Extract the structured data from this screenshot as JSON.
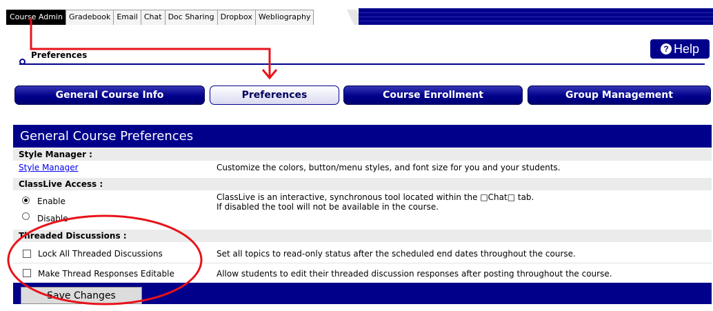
{
  "top_tabs": [
    "Course Admin",
    "Gradebook",
    "Email",
    "Chat",
    "Doc Sharing",
    "Dropbox",
    "Webliography"
  ],
  "page": {
    "title": "Preferences",
    "help_label": "Help"
  },
  "nav_buttons": [
    "General Course Info",
    "Preferences",
    "Course Enrollment",
    "Group Management"
  ],
  "panel": {
    "title": "General Course Preferences",
    "style_manager": {
      "heading": "Style Manager :",
      "link": "Style Manager",
      "description": "Customize the colors, button/menu styles, and font size for you and your students."
    },
    "classlive": {
      "heading": "ClassLive Access :",
      "enable_label": "Enable",
      "disable_label": "Disable",
      "enable_checked": true,
      "description_line1": "ClassLive is an interactive, synchronous tool located within the □Chat□ tab.",
      "description_line2": "If disabled the tool will not be available in the course."
    },
    "threaded": {
      "heading": "Threaded Discussions :",
      "lock_label": "Lock All Threaded Discussions",
      "lock_checked": false,
      "lock_description": "Set all topics to read-only status after the scheduled end dates throughout the course.",
      "editable_label": "Make Thread Responses Editable",
      "editable_checked": false,
      "editable_description": "Allow students to edit their threaded discussion responses after posting throughout the course."
    },
    "save_label": "Save Changes"
  },
  "colors": {
    "brand_navy": "#00008b",
    "annotation_red": "#e8121a"
  }
}
